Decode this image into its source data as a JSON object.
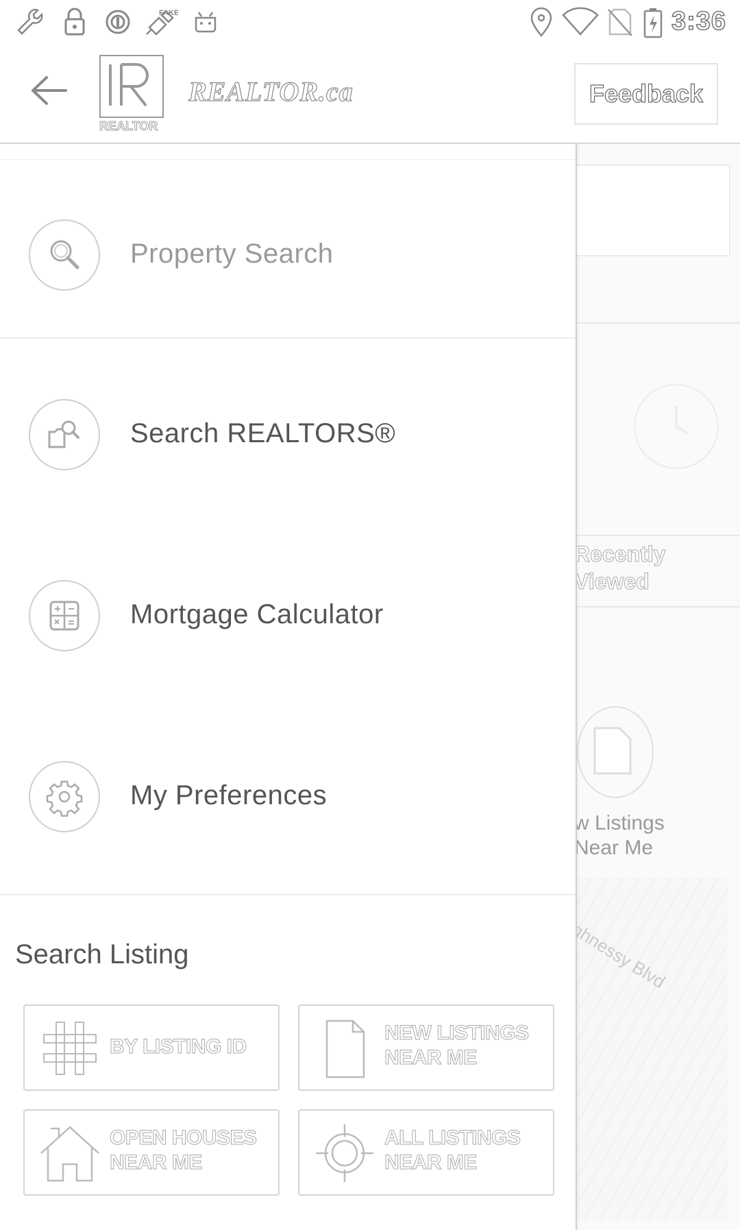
{
  "status_bar": {
    "time": "3:36",
    "icons": [
      "wrench-icon",
      "lock-icon",
      "circle-icon",
      "satellite-icon",
      "android-icon",
      "location-icon",
      "wifi-icon",
      "no-sim-icon",
      "battery-charging-icon"
    ]
  },
  "app_bar": {
    "back_icon": "arrow-left-icon",
    "logo_text": "REALTOR",
    "brand": "REALTOR.ca",
    "feedback_label": "Feedback"
  },
  "drawer": {
    "menu": [
      {
        "label": "Property Search",
        "icon": "search-icon"
      },
      {
        "label": "Search REALTORS®",
        "icon": "agent-search-icon"
      },
      {
        "label": "Mortgage Calculator",
        "icon": "calculator-icon"
      },
      {
        "label": "My Preferences",
        "icon": "gear-icon"
      }
    ],
    "section_title": "Search Listing",
    "tiles": [
      {
        "line1": "BY LISTING ID",
        "line2": "",
        "icon": "hashtag-icon"
      },
      {
        "line1": "NEW LISTINGS",
        "line2": "NEAR ME",
        "icon": "document-icon"
      },
      {
        "line1": "OPEN HOUSES",
        "line2": "NEAR ME",
        "icon": "house-icon"
      },
      {
        "line1": "ALL LISTINGS",
        "line2": "NEAR ME",
        "icon": "target-icon"
      }
    ]
  },
  "background": {
    "recently_viewed": [
      "Recently",
      "Viewed"
    ],
    "new_listings": [
      "w Listings",
      "Near Me"
    ],
    "street": "ghnessy Blvd"
  },
  "colors": {
    "text": "#555555",
    "muted": "#9a9a9a",
    "border": "#d4d4d4"
  }
}
